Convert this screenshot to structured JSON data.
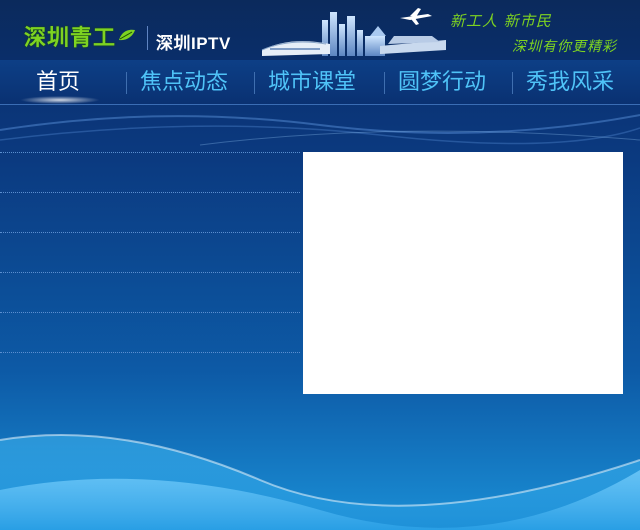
{
  "header": {
    "logo_text": "深圳青工",
    "brand": "深圳IPTV",
    "slogan_line1": "新工人 新市民",
    "slogan_line2": "深圳有你更精彩"
  },
  "nav": {
    "items": [
      {
        "label": "首页",
        "active": true
      },
      {
        "label": "焦点动态",
        "active": false
      },
      {
        "label": "城市课堂",
        "active": false
      },
      {
        "label": "圆梦行动",
        "active": false
      },
      {
        "label": "秀我风采",
        "active": false
      }
    ]
  },
  "colors": {
    "accent_green": "#7ed321",
    "nav_blue": "#4fc3f7",
    "background_dark": "#0a2a66"
  }
}
